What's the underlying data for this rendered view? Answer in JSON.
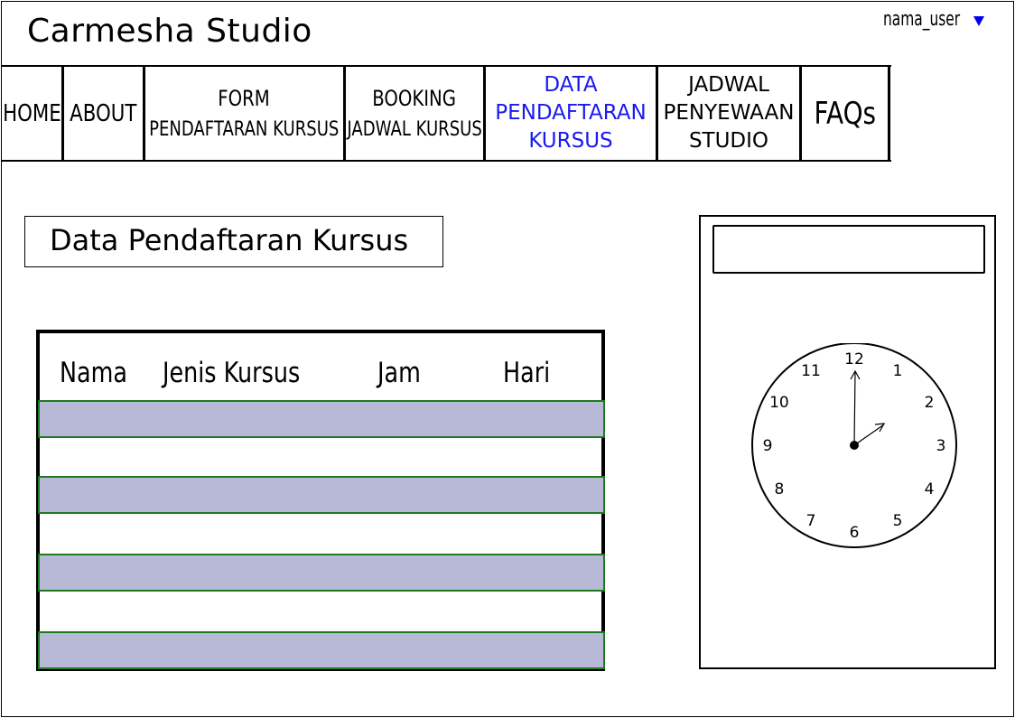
{
  "app": {
    "title": "Carmesha Studio"
  },
  "user": {
    "name": "nama_user",
    "caret_color": "#0000ee"
  },
  "nav": {
    "home": "HOME",
    "about": "ABOUT",
    "form": {
      "line1": "FORM",
      "line2": "PENDAFTARAN KURSUS"
    },
    "booking": {
      "line1": "BOOKING",
      "line2": "JADWAL KURSUS"
    },
    "data": {
      "line1": "DATA",
      "line2": "PENDAFTARAN",
      "line3": "KURSUS",
      "active_color": "#1a1aee"
    },
    "jadwal": {
      "line1": "JADWAL",
      "line2": "PENYEWAAN",
      "line3": "STUDIO"
    },
    "faq": "FAQs"
  },
  "page": {
    "heading": "Data Pendaftaran Kursus"
  },
  "table": {
    "columns": [
      "Nama",
      "Jenis Kursus",
      "Jam",
      "Hari"
    ],
    "row_fill": "#b7b9d7",
    "row_border": "#1f7a1f"
  },
  "widget": {
    "input_value": "",
    "clock": {
      "numbers": [
        "12",
        "1",
        "2",
        "3",
        "4",
        "5",
        "6",
        "7",
        "8",
        "9",
        "10",
        "11"
      ],
      "time": "2:00"
    }
  }
}
